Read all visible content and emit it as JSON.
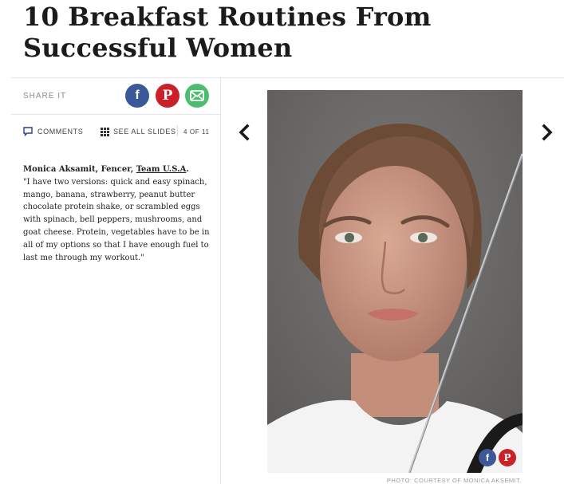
{
  "article": {
    "title": "10 Breakfast Routines From Successful Women"
  },
  "share": {
    "label": "SHARE IT",
    "facebook_glyph": "f",
    "pinterest_glyph": "P",
    "icons": [
      "facebook-icon",
      "pinterest-icon",
      "mail-icon"
    ],
    "colors": {
      "facebook": "#3b5998",
      "pinterest": "#cb2027",
      "mail": "#4cbd6d"
    }
  },
  "meta": {
    "comments_label": "COMMENTS",
    "see_all_label": "SEE ALL SLIDES",
    "slide_counter": "4 OF 11"
  },
  "slide": {
    "name_line": "Monica Aksamit, Fencer, ",
    "team_link": "Team U.S.A",
    "period": ".",
    "quote": "\"I have two versions: quick and easy spinach, mango, banana, strawberry, peanut butter chocolate protein shake, or scrambled eggs with spinach, bell peppers, mushrooms, and goat cheese. Protein, vegetables have to be in all of my options so that I have enough fuel to last me through my workout.\"",
    "photo_credit": "PHOTO: COURTESY OF MONICA AKSEMIT."
  },
  "nav": {
    "prev_icon": "chevron-left-icon",
    "next_icon": "chevron-right-icon"
  }
}
